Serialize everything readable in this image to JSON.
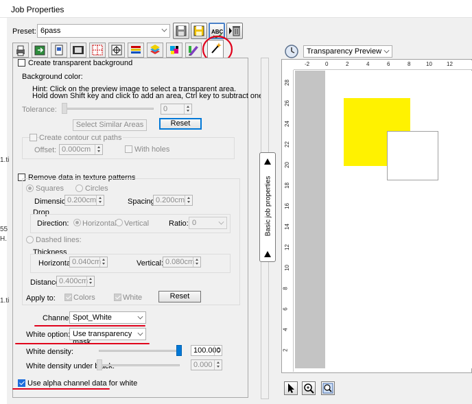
{
  "window": {
    "title": "Job Properties"
  },
  "left_strip_text": [
    "1.ti",
    "55",
    "H.",
    "1.ti"
  ],
  "preset": {
    "label": "Preset:",
    "value": "6pass"
  },
  "toolbar_icons": [
    "save-icon",
    "save-as-icon",
    "spellcheck-icon",
    "delete-icon"
  ],
  "tab_icons": [
    "printer-icon",
    "layout-icon",
    "media-icon",
    "film-icon",
    "grid-icon",
    "target-icon",
    "color-bars-icon",
    "layers-icon",
    "cmyk-icon",
    "color-pencil-icon",
    "magic-wand-icon"
  ],
  "transparent_bg": {
    "checkbox_label": "Create transparent background",
    "checked": false,
    "bg_color_label": "Background color:",
    "hint1": "Hint: Click on the preview image to select a transparent area.",
    "hint2": "Hold down Shift key and click to add an area, Ctrl key to subtract one.",
    "tolerance_label": "Tolerance:",
    "tolerance_value": "0",
    "select_similar_label": "Select Similar Areas",
    "reset_label": "Reset",
    "contour_label": "Create contour cut paths",
    "offset_label": "Offset:",
    "offset_value": "0.000cm",
    "with_holes_label": "With holes"
  },
  "texture": {
    "checkbox_label": "Remove data in texture patterns",
    "checked": false,
    "squares_label": "Squares",
    "circles_label": "Circles",
    "dimension_label": "Dimension:",
    "dimension_value": "0.200cm",
    "spacing_label": "Spacing:",
    "spacing_value": "0.200cm",
    "drop_label": "Drop",
    "direction_label": "Direction:",
    "horizontal_label": "Horizontal",
    "vertical_label": "Vertical",
    "ratio_label": "Ratio:",
    "ratio_value": "0",
    "dashed_label": "Dashed lines:",
    "thickness_label": "Thickness",
    "th_horizontal_label": "Horizontal:",
    "th_horizontal_value": "0.040cm",
    "th_vertical_label": "Vertical:",
    "th_vertical_value": "0.080cm",
    "distance_label": "Distance:",
    "distance_value": "0.400cm",
    "apply_to_label": "Apply to:",
    "colors_label": "Colors",
    "white_label": "White",
    "reset_label": "Reset"
  },
  "channel": {
    "label": "Channel:",
    "value": "Spot_White"
  },
  "white_option": {
    "label": "White option:",
    "value": "Use transparency mask"
  },
  "white_density": {
    "label": "White density:",
    "value": "100.000",
    "level_percent": 100
  },
  "white_density_black": {
    "label": "White density under black:",
    "value": "0.000",
    "level_percent": 0
  },
  "alpha": {
    "label": "Use alpha channel data for white",
    "checked": true
  },
  "side_tab": {
    "label": "Basic job properties"
  },
  "preview": {
    "mode": "Transparency Preview",
    "ruler_h": [
      "-2",
      "0",
      "2",
      "4",
      "6",
      "8",
      "10",
      "12"
    ],
    "ruler_v": [
      "28",
      "26",
      "24",
      "22",
      "20",
      "18",
      "16",
      "14",
      "12",
      "10",
      "8",
      "6",
      "4",
      "2"
    ],
    "shapes": {
      "yellow": "#fff200",
      "white_outline": "#a0a0a0"
    }
  },
  "bottom_tools": [
    "pointer-icon",
    "zoom-in-icon",
    "zoom-fit-icon"
  ],
  "colors": {
    "accent": "#0078d7",
    "annotation_red": "#e0001b",
    "yellow": "#fff200"
  }
}
